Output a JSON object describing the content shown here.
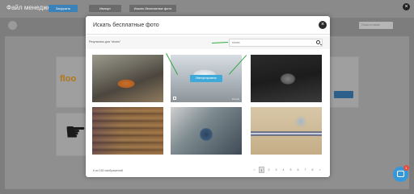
{
  "background_page": {
    "title": "Файл менеджер",
    "buttons": [
      "Загрузить",
      "Импорт",
      "Искать бесплатные фото"
    ],
    "search_placeholder": "Поиск в папке"
  },
  "modal": {
    "title": "Искать бесплатные фото",
    "results_label": "Результаты для \"shoes\"",
    "search": {
      "value": "",
      "placeholder": "shoes"
    },
    "upload_label": "Импортировать",
    "credit": "Pexels",
    "footer_count": "6 из 150 изображений",
    "pagination": [
      "<",
      "1",
      "2",
      "3",
      "4",
      "5",
      "6",
      "7",
      "8",
      ">"
    ],
    "active_page": "1"
  },
  "chat": {
    "badge": "1"
  }
}
